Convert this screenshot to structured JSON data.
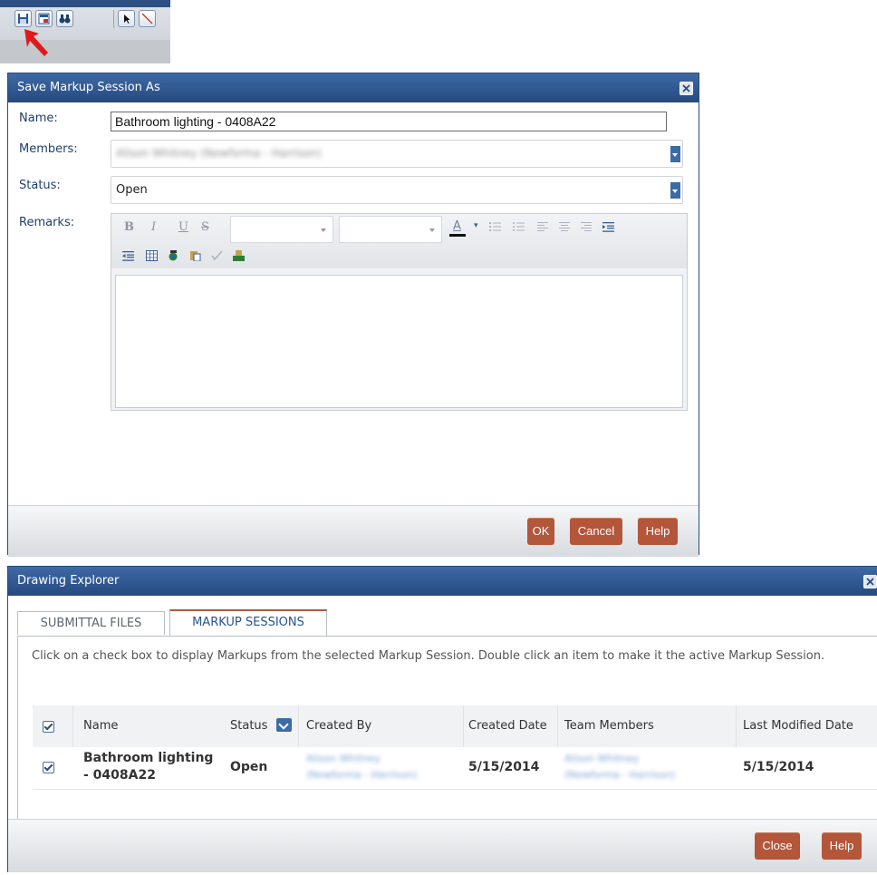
{
  "toolbar": {
    "icons": [
      "save-icon",
      "export-icon",
      "binoculars-icon",
      "select-arrow-icon",
      "draw-line-icon"
    ],
    "highlight": "red-arrow-pointer-icon"
  },
  "save_dialog": {
    "title": "Save Markup Session As",
    "name_label": "Name:",
    "name_value": "Bathroom lighting - 0408A22",
    "members_label": "Members:",
    "members_value": "Alison Whitney (Newforma - Harrison)",
    "status_label": "Status:",
    "status_value": "Open",
    "remarks_label": "Remarks:",
    "editor": {
      "bold": "B",
      "italic": "I",
      "underline": "U",
      "strike": "S",
      "font_color": "A",
      "font_value": "",
      "size_value": "",
      "remarks_text": ""
    },
    "buttons": {
      "ok": "OK",
      "cancel": "Cancel",
      "help": "Help"
    }
  },
  "explorer": {
    "title": "Drawing Explorer",
    "tabs": [
      {
        "label": "SUBMITTAL FILES",
        "active": false
      },
      {
        "label": "MARKUP SESSIONS",
        "active": true
      }
    ],
    "instruction": "Click on a check box to display Markups from the selected Markup Session. Double click an item to make it the active Markup Session.",
    "columns": {
      "name": "Name",
      "status": "Status",
      "created_by": "Created By",
      "created_date": "Created Date",
      "team_members": "Team Members",
      "last_modified": "Last Modified Date"
    },
    "rows": [
      {
        "checked": true,
        "name_line1": "Bathroom lighting",
        "name_line2": "- 0408A22",
        "status": "Open",
        "created_by_line1": "Alison Whitney",
        "created_by_line2": "(Newforma - Harrison)",
        "created_date": "5/15/2014",
        "team_members_line1": "Alison Whitney",
        "team_members_line2": "(Newforma - Harrison)",
        "last_modified": "5/15/2014"
      }
    ],
    "buttons": {
      "close": "Close",
      "help": "Help"
    }
  },
  "colors": {
    "title_bar": "#2f5a93",
    "button": "#b3563a",
    "dropdown_accent": "#3d6ba6"
  }
}
